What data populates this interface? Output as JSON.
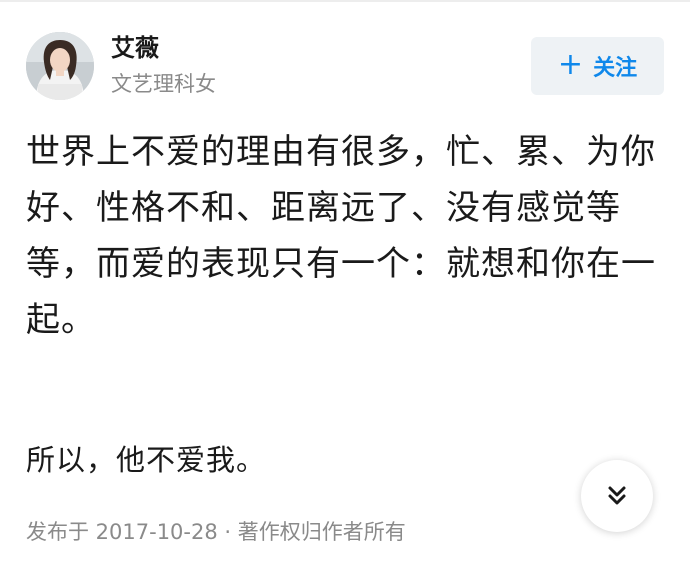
{
  "author": {
    "name": "艾薇",
    "bio": "文艺理科女",
    "avatar_icon": "user-avatar-photo"
  },
  "follow_button": {
    "icon": "plus-icon",
    "icon_glyph": "+",
    "label": "关注"
  },
  "post": {
    "paragraph_1": "世界上不爱的理由有很多，忙、累、为你好、性格不和、距离远了、没有感觉等等，而爱的表现只有一个：就想和你在一起。",
    "paragraph_2": "所以，他不爱我。",
    "meta": "发布于 2017-10-28 · 著作权归作者所有"
  },
  "scroll_button": {
    "icon": "double-chevron-down-icon"
  },
  "colors": {
    "accent": "#0f88eb",
    "text_primary": "#1a1a1a",
    "text_secondary": "#8a8a8a",
    "button_bg": "#eef2f5"
  }
}
